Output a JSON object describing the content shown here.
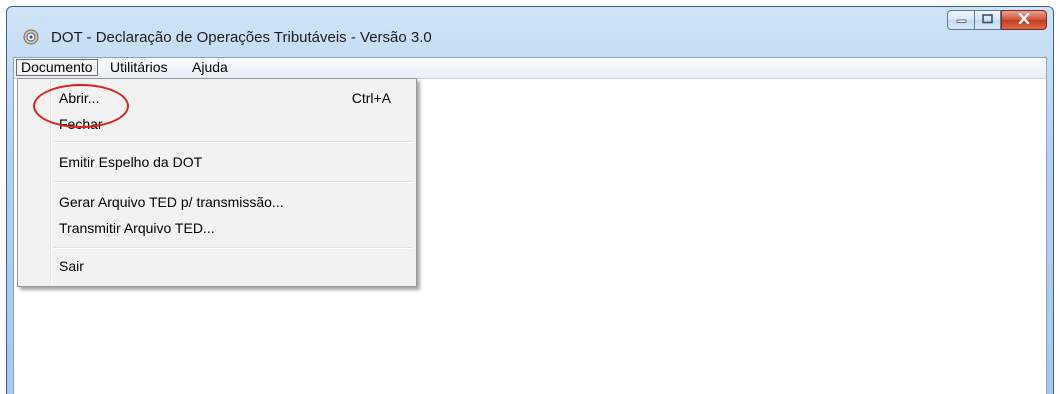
{
  "window": {
    "title": "DOT - Declaração de Operações Tributáveis  - Versão 3.0",
    "icon": "app-seal-icon",
    "controls": {
      "minimize_icon": "minimize-icon",
      "maximize_icon": "maximize-icon",
      "close_icon": "close-icon",
      "close_color": "#c33b1c"
    }
  },
  "menubar": {
    "items": [
      {
        "label": "Documento",
        "active": true
      },
      {
        "label": "Utilitários",
        "active": false
      },
      {
        "label": "Ajuda",
        "active": false
      }
    ]
  },
  "dropdown": {
    "items": [
      {
        "label": "Abrir...",
        "shortcut": "Ctrl+A"
      },
      {
        "label": "Fechar",
        "shortcut": ""
      },
      {
        "label": "Emitir Espelho da DOT",
        "shortcut": ""
      },
      {
        "label": "Gerar Arquivo TED p/ transmissão...",
        "shortcut": ""
      },
      {
        "label": "Transmitir Arquivo TED...",
        "shortcut": ""
      },
      {
        "label": "Sair",
        "shortcut": ""
      }
    ]
  },
  "annotation": {
    "shape": "ellipse",
    "color": "#e0211c",
    "target": "Abrir..."
  }
}
